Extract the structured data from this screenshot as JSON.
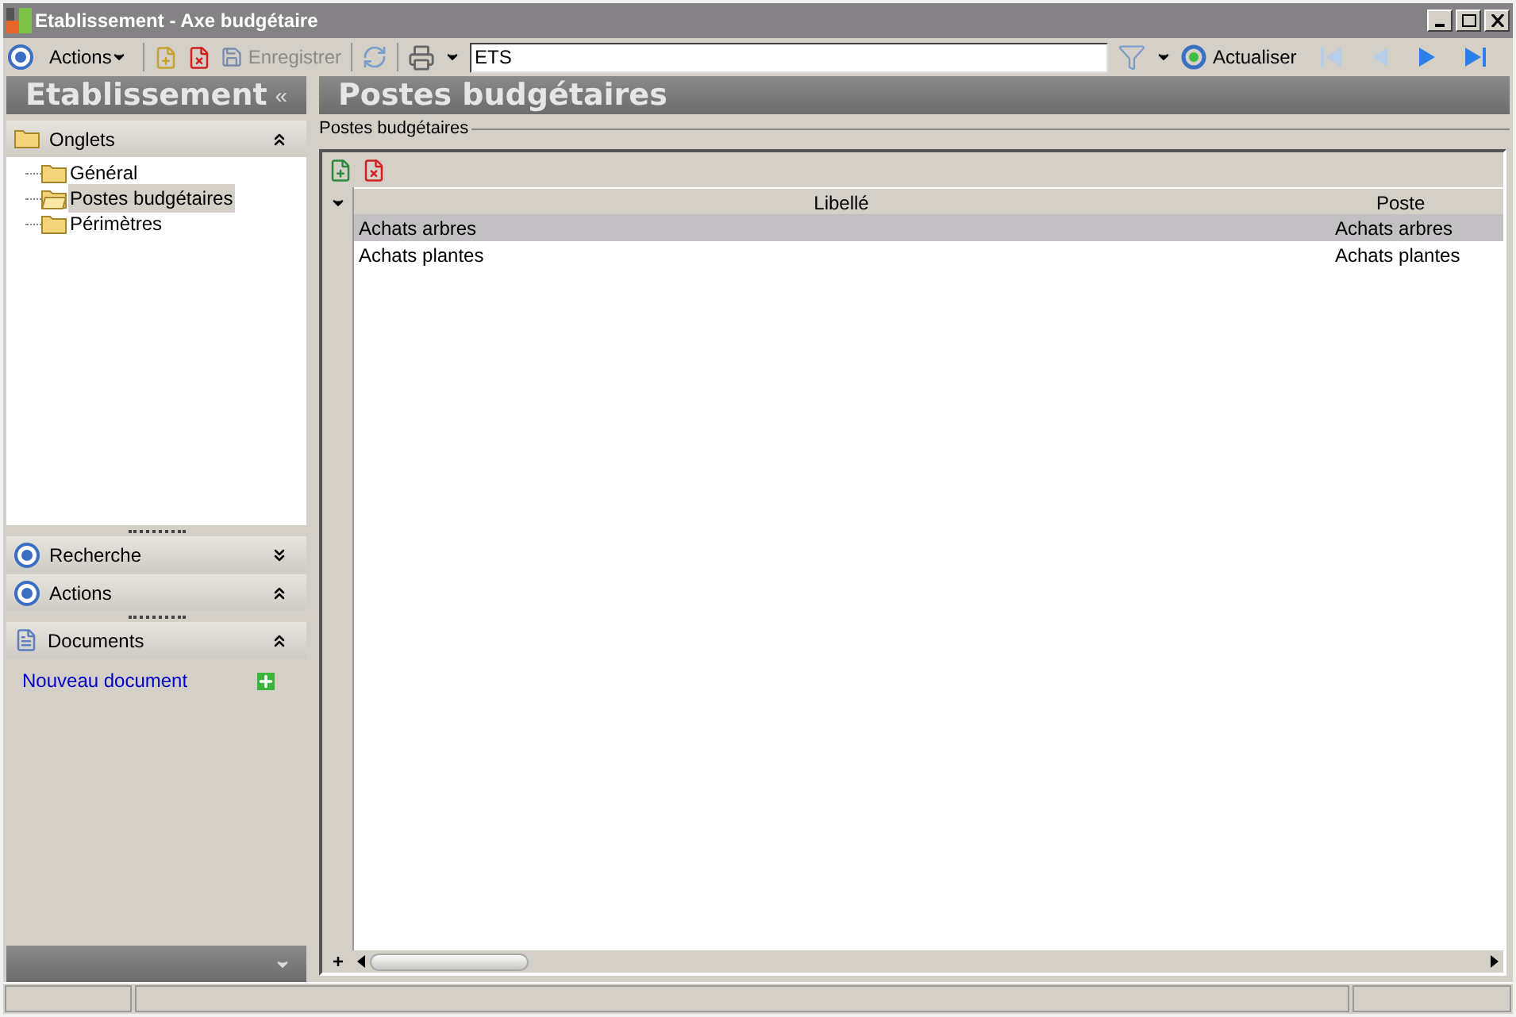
{
  "window": {
    "title": "Etablissement -  Axe budgétaire"
  },
  "toolbar": {
    "actions_label": "Actions",
    "save": {
      "label": "Enregistrer",
      "disabled": true
    },
    "search": {
      "value": "ETS"
    },
    "refresh_label": "Actualiser"
  },
  "sidebar": {
    "title": "Etablissement",
    "collapse": "«",
    "sections": [
      {
        "kind": "tree",
        "title": "Onglets",
        "expanded": true,
        "items": [
          {
            "label": "Général",
            "selected": false
          },
          {
            "label": "Postes budgétaires",
            "selected": true
          },
          {
            "label": "Périmètres",
            "selected": false
          }
        ]
      },
      {
        "kind": "search",
        "title": "Recherche",
        "expanded": false
      },
      {
        "kind": "actions",
        "title": "Actions",
        "expanded": true
      },
      {
        "kind": "documents",
        "title": "Documents",
        "expanded": true,
        "link": "Nouveau document"
      }
    ]
  },
  "main": {
    "title": "Postes budgétaires",
    "group_label": "Postes budgétaires",
    "table": {
      "columns": [
        "Libellé",
        "Poste"
      ],
      "rows": [
        {
          "cells": [
            "Achats arbres",
            "Achats arbres"
          ],
          "selected": true
        },
        {
          "cells": [
            "Achats plantes",
            "Achats plantes"
          ],
          "selected": false
        }
      ],
      "add_row": "+"
    }
  }
}
